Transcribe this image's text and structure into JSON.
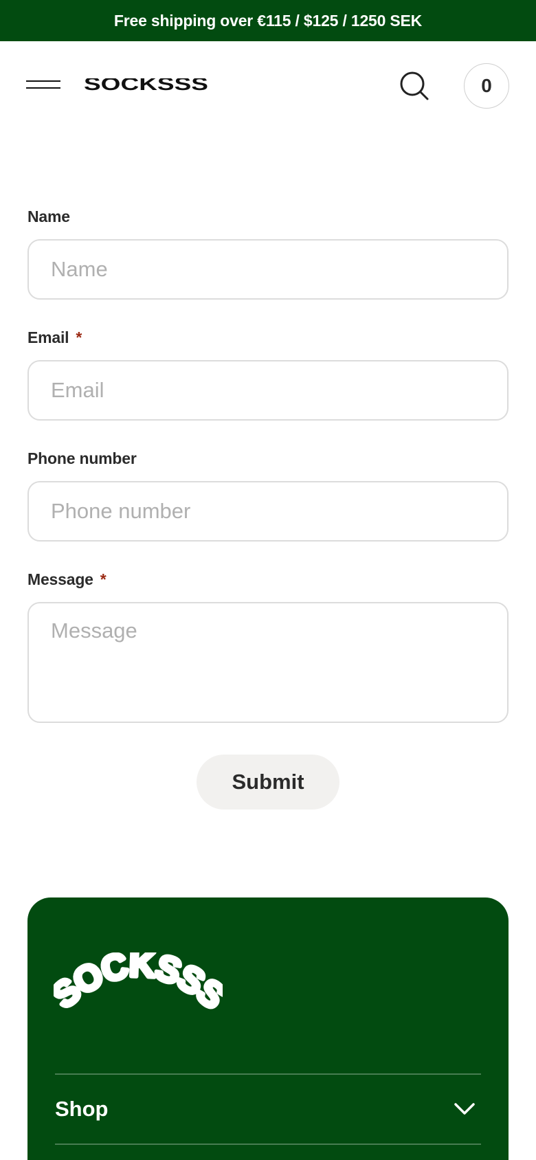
{
  "announcement": {
    "text": "Free shipping over €115 / $125 / 1250 SEK"
  },
  "header": {
    "menu_icon": "hamburger-menu-icon",
    "brand": "SOCKSSS",
    "search_icon": "search-icon",
    "cart_count": "0"
  },
  "form": {
    "fields": [
      {
        "label": "Name",
        "placeholder": "Name",
        "required": false,
        "value": ""
      },
      {
        "label": "Email",
        "placeholder": "Email",
        "required": true,
        "value": ""
      },
      {
        "label": "Phone number",
        "placeholder": "Phone number",
        "required": false,
        "value": ""
      },
      {
        "label": "Message",
        "placeholder": "Message",
        "required": true,
        "value": ""
      }
    ],
    "required_mark": "*",
    "submit_label": "Submit"
  },
  "footer": {
    "logo": "SOCKSSS",
    "menu": [
      {
        "label": "Shop",
        "icon": "chevron-down-icon"
      }
    ]
  },
  "colors": {
    "brand_green": "#024b10",
    "required_red": "#9b2a14",
    "button_bg": "#f2f1ef",
    "input_border": "#dcdcdc"
  }
}
